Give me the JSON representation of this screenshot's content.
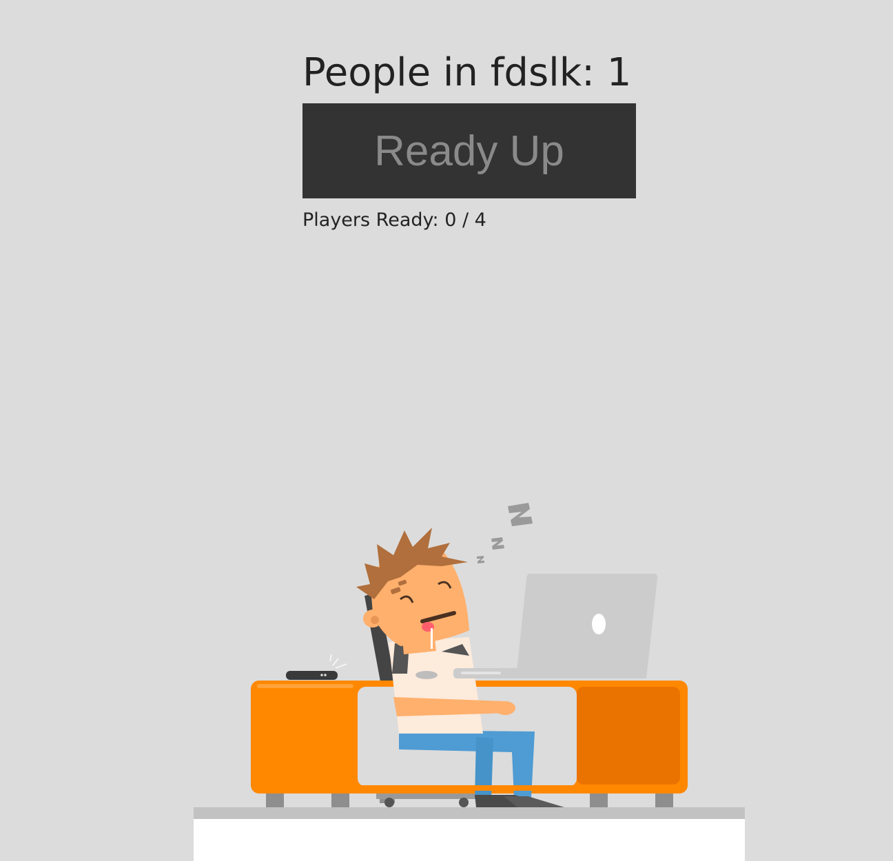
{
  "lobby": {
    "title": "People in fdslk: 1",
    "ready_button_label": "Ready Up",
    "ready_status": "Players Ready: 0 / 4"
  },
  "illustration": {
    "subject": "sleeping-office-worker",
    "sleep_text": "Z z z"
  },
  "colors": {
    "background": "#dcdcdc",
    "button_bg": "#333333",
    "button_text": "#8a8a8a",
    "desk_orange": "#ff8800",
    "desk_dark_orange": "#ea7300",
    "jeans": "#4f9bd3",
    "skin": "#ffb06d",
    "hair": "#b06f3c",
    "laptop": "#cccccc"
  }
}
